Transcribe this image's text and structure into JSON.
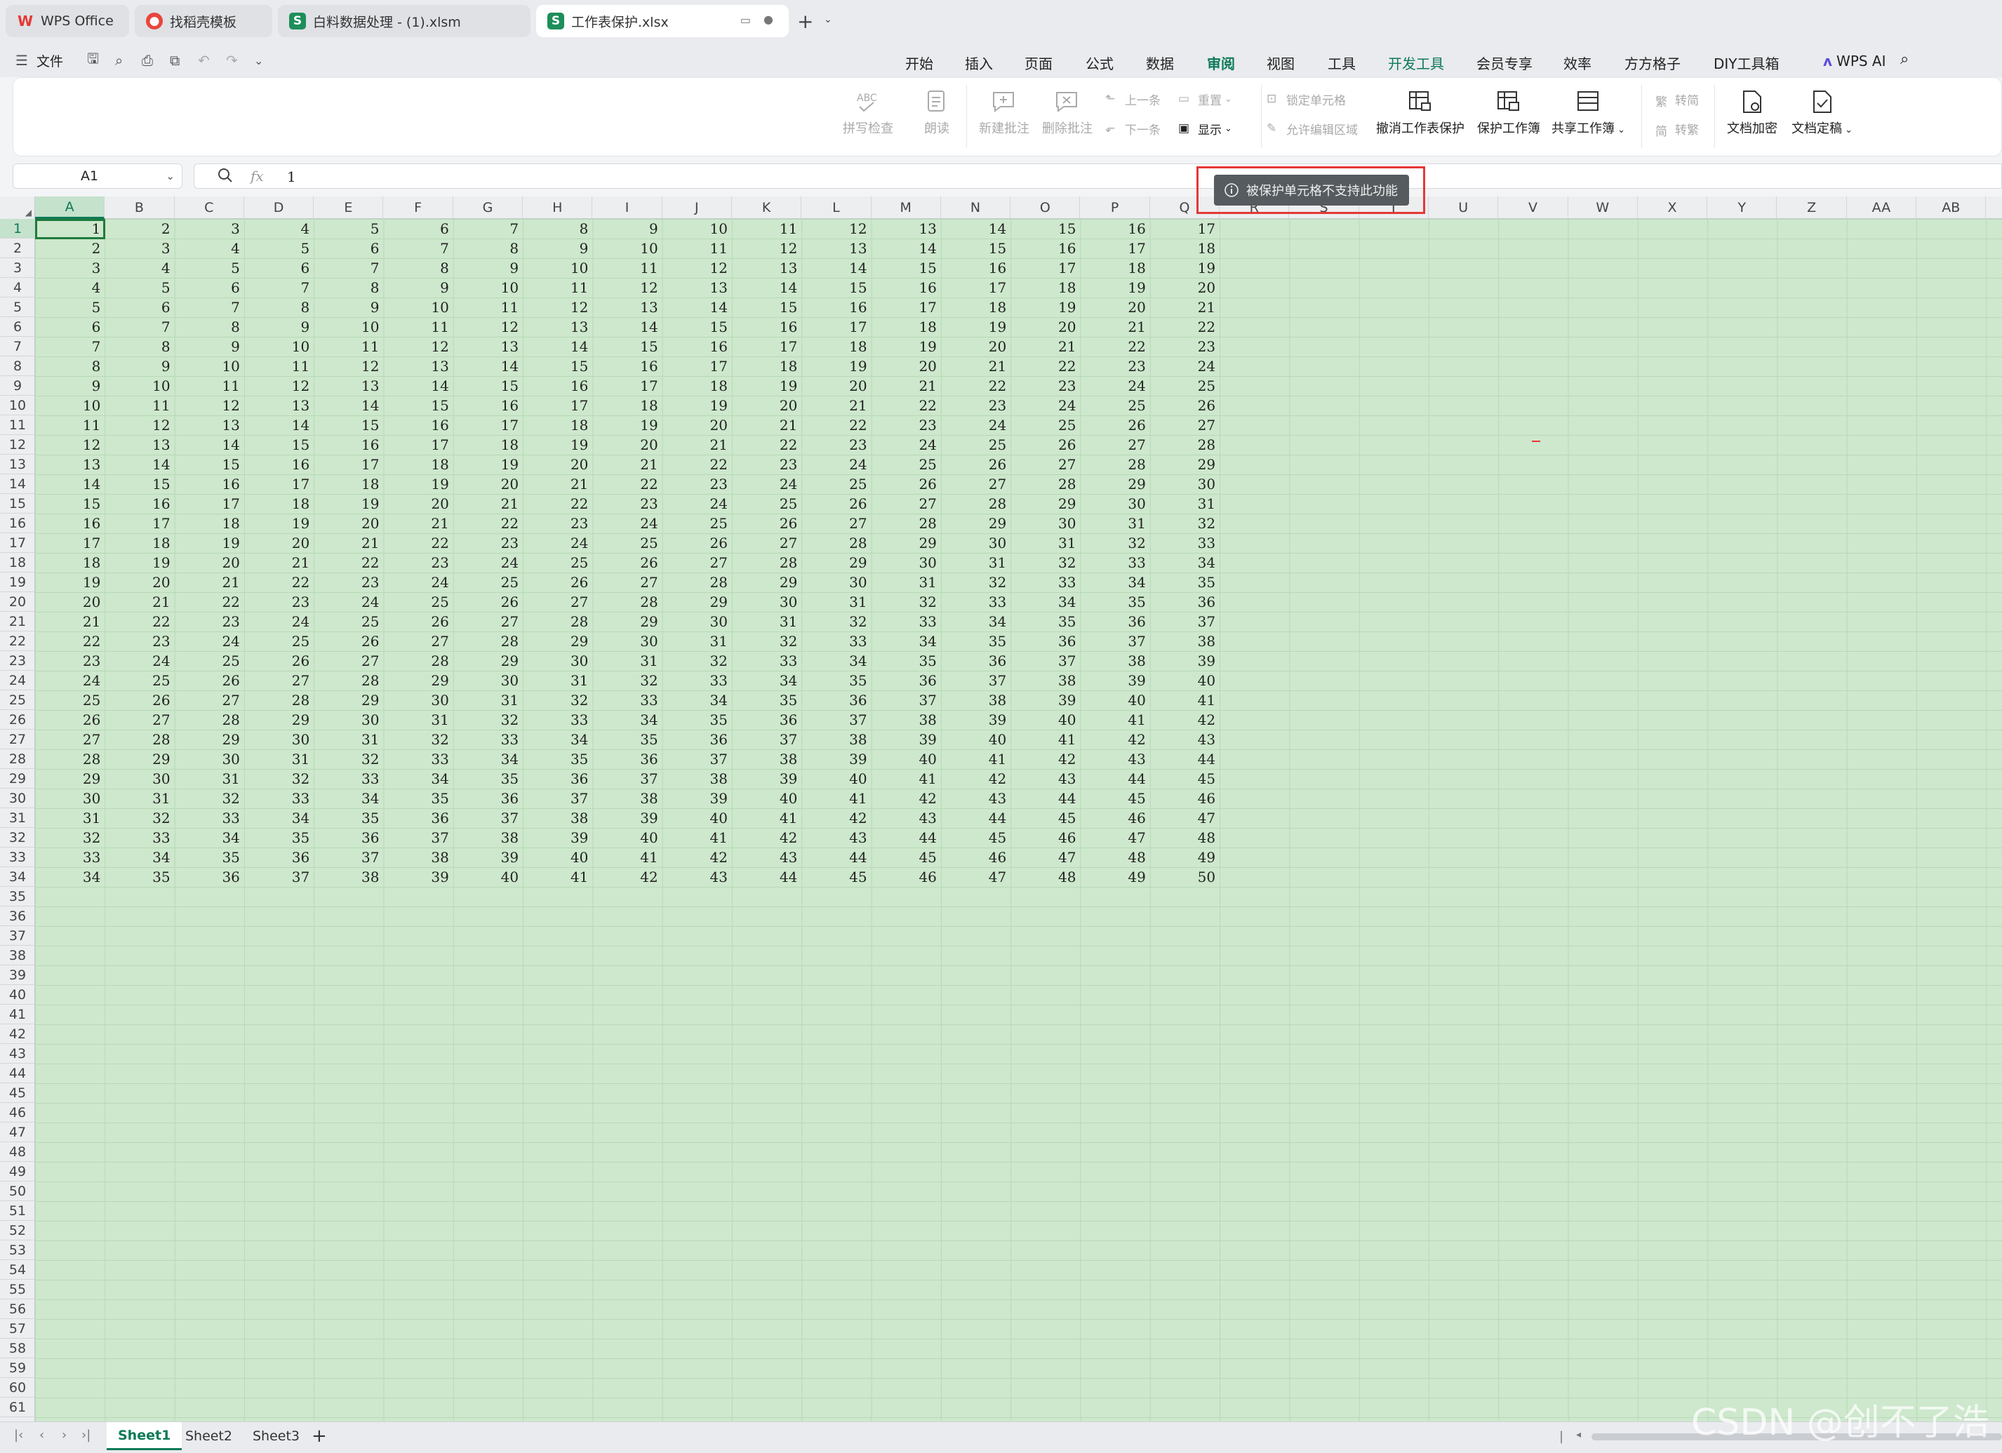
{
  "tabs": [
    {
      "label": "WPS Office",
      "icon": "wps-logo-icon",
      "active": false
    },
    {
      "label": "找稻壳模板",
      "icon": "docer-icon",
      "active": false
    },
    {
      "label": "白料数据处理 - (1).xlsm",
      "icon": "spreadsheet-icon",
      "active": false
    },
    {
      "label": "工作表保护.xlsx",
      "icon": "spreadsheet-icon",
      "active": true
    }
  ],
  "quick_access": {
    "file_label": "文件"
  },
  "menus": [
    "开始",
    "插入",
    "页面",
    "公式",
    "数据",
    "审阅",
    "视图",
    "工具",
    "开发工具",
    "会员专享",
    "效率",
    "方方格子",
    "DIY工具箱"
  ],
  "active_menu": "审阅",
  "wps_ai_label": "WPS AI",
  "ribbon": {
    "spellcheck": "拼写检查",
    "read_aloud": "朗读",
    "new_comment": "新建批注",
    "delete_comment": "删除批注",
    "prev": "上一条",
    "next": "下一条",
    "reset": "重置",
    "show": "显示",
    "lock_cell": "锁定单元格",
    "allow_edit_range": "允许编辑区域",
    "unprotect_sheet": "撤消工作表保护",
    "protect_workbook": "保护工作簿",
    "share_workbook": "共享工作簿",
    "to_simplified": "转简",
    "to_traditional": "转繁",
    "doc_encrypt": "文档加密",
    "doc_finalize": "文档定稿"
  },
  "formula_bar": {
    "name_box": "A1",
    "fx": "fx",
    "value": "1"
  },
  "toast": {
    "message": "被保护单元格不支持此功能"
  },
  "columns": [
    "A",
    "B",
    "C",
    "D",
    "E",
    "F",
    "G",
    "H",
    "I",
    "J",
    "K",
    "L",
    "M",
    "N",
    "O",
    "P",
    "Q",
    "R",
    "S",
    "T",
    "U",
    "V",
    "W",
    "X",
    "Y",
    "Z",
    "AA",
    "AB"
  ],
  "selected_cell": "A1",
  "data_rows": 34,
  "data_cols": 17,
  "visible_rows": 61,
  "sheet_tabs": [
    "Sheet1",
    "Sheet2",
    "Sheet3"
  ],
  "active_sheet": "Sheet1",
  "watermark": "CSDN @创不了浩",
  "colors": {
    "accent": "#0d7a57",
    "cell_bg": "#cde8cc",
    "toast_border": "#e53935"
  }
}
